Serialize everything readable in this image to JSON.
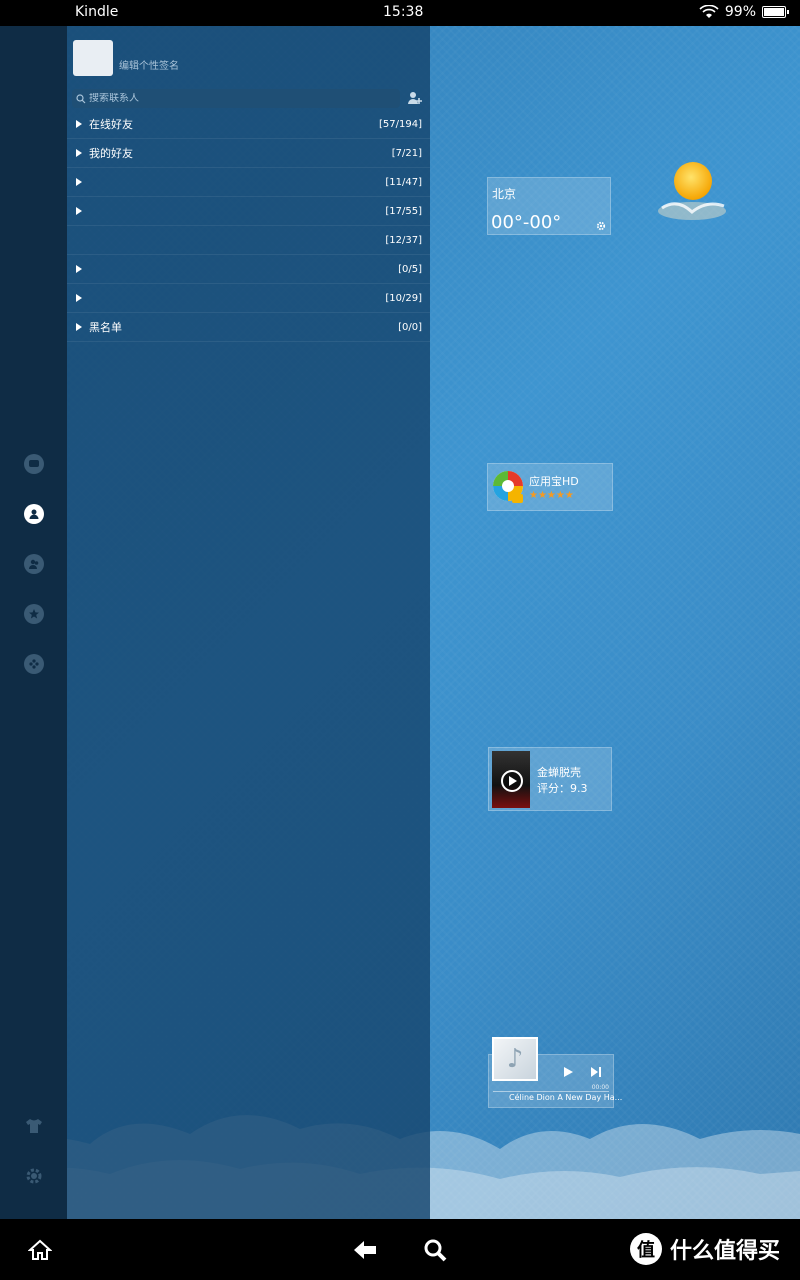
{
  "status_bar": {
    "carrier": "Kindle",
    "time": "15:38",
    "battery": "99%"
  },
  "profile": {
    "signature": "编辑个性签名"
  },
  "search": {
    "placeholder": "搜索联系人"
  },
  "groups": [
    {
      "name": "在线好友",
      "count": "[57/194]"
    },
    {
      "name": "我的好友",
      "count": "[7/21]"
    },
    {
      "name": "",
      "count": "[11/47]"
    },
    {
      "name": "",
      "count": "[17/55]"
    },
    {
      "name": "",
      "count": "[12/37]"
    },
    {
      "name": "",
      "count": "[0/5]"
    },
    {
      "name": "",
      "count": "[10/29]"
    },
    {
      "name": "黑名单",
      "count": "[0/0]"
    }
  ],
  "weather": {
    "city": "北京",
    "temperature": "00°-00°"
  },
  "app_widget": {
    "name": "应用宝HD",
    "stars": "★★★★★"
  },
  "movie_widget": {
    "title": "金蝉脱壳",
    "score": "评分：9.3"
  },
  "music_widget": {
    "time": "00:00",
    "song": "Céline Dion  A New Day Ha..."
  },
  "watermark": {
    "badge": "值",
    "text": "什么值得买"
  },
  "colors": {
    "rail": "#0f2c45",
    "panel": "#16466e",
    "background": "#3e95d0",
    "stars": "#f39a24"
  }
}
